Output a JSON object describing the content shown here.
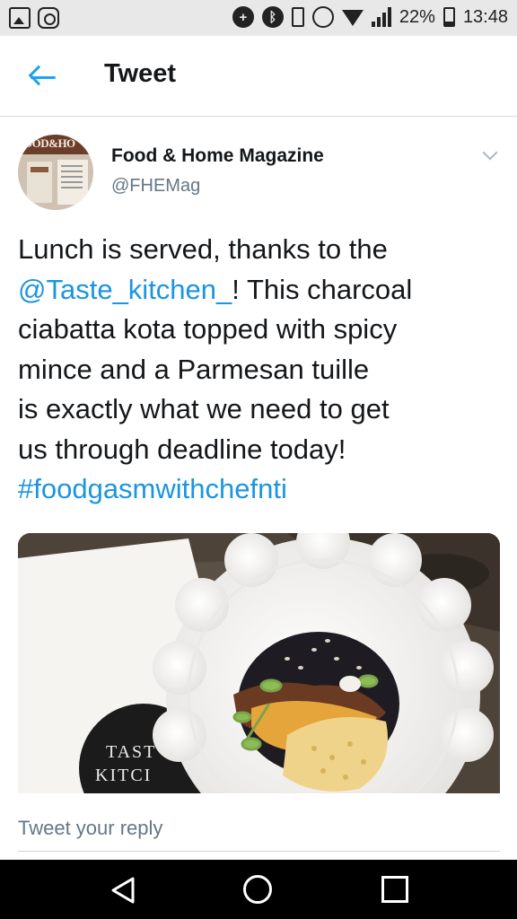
{
  "status_bar": {
    "left_icons": [
      "gallery-icon",
      "instagram-icon"
    ],
    "right_icons": [
      "data-saver-icon",
      "bluetooth-icon",
      "vibrate-icon",
      "alarm-icon",
      "wifi-icon",
      "signal-icon",
      "battery-icon"
    ],
    "battery_percent": "22%",
    "time": "13:48"
  },
  "header": {
    "back_icon": "arrow-left-icon",
    "title": "Tweet"
  },
  "tweet": {
    "author_name": "Food & Home Magazine",
    "author_handle": "@FHEMag",
    "avatar_logo_text": "OOD&HO",
    "menu_icon": "chevron-down-icon",
    "text_lines": [
      {
        "plain": "Lunch is served, thanks to the",
        "link": ""
      },
      {
        "link": "@Taste_kitchen_",
        "plain": "! This charcoal"
      },
      {
        "plain": "ciabatta kota topped with spicy",
        "link": ""
      },
      {
        "plain": "mince and a Parmesan tuille",
        "link": ""
      },
      {
        "plain": "is exactly what we need to get",
        "link": ""
      },
      {
        "plain": "us through deadline today!",
        "link": ""
      },
      {
        "link": "#foodgasmwithchefnti",
        "plain": ""
      }
    ],
    "photo_card_text_1": "TAST",
    "photo_card_text_2": "KITCI"
  },
  "reply": {
    "placeholder": "Tweet your reply"
  },
  "nav_bar": {
    "back_icon": "triangle-back-icon",
    "home_icon": "circle-home-icon",
    "recents_icon": "square-recents-icon"
  },
  "colors": {
    "link": "#1b95e0",
    "accent": "#1da1f2",
    "text": "#14171a",
    "secondary_text": "#657786",
    "status_bar_bg": "#e8e8e8",
    "nav_bar_bg": "#000000"
  }
}
